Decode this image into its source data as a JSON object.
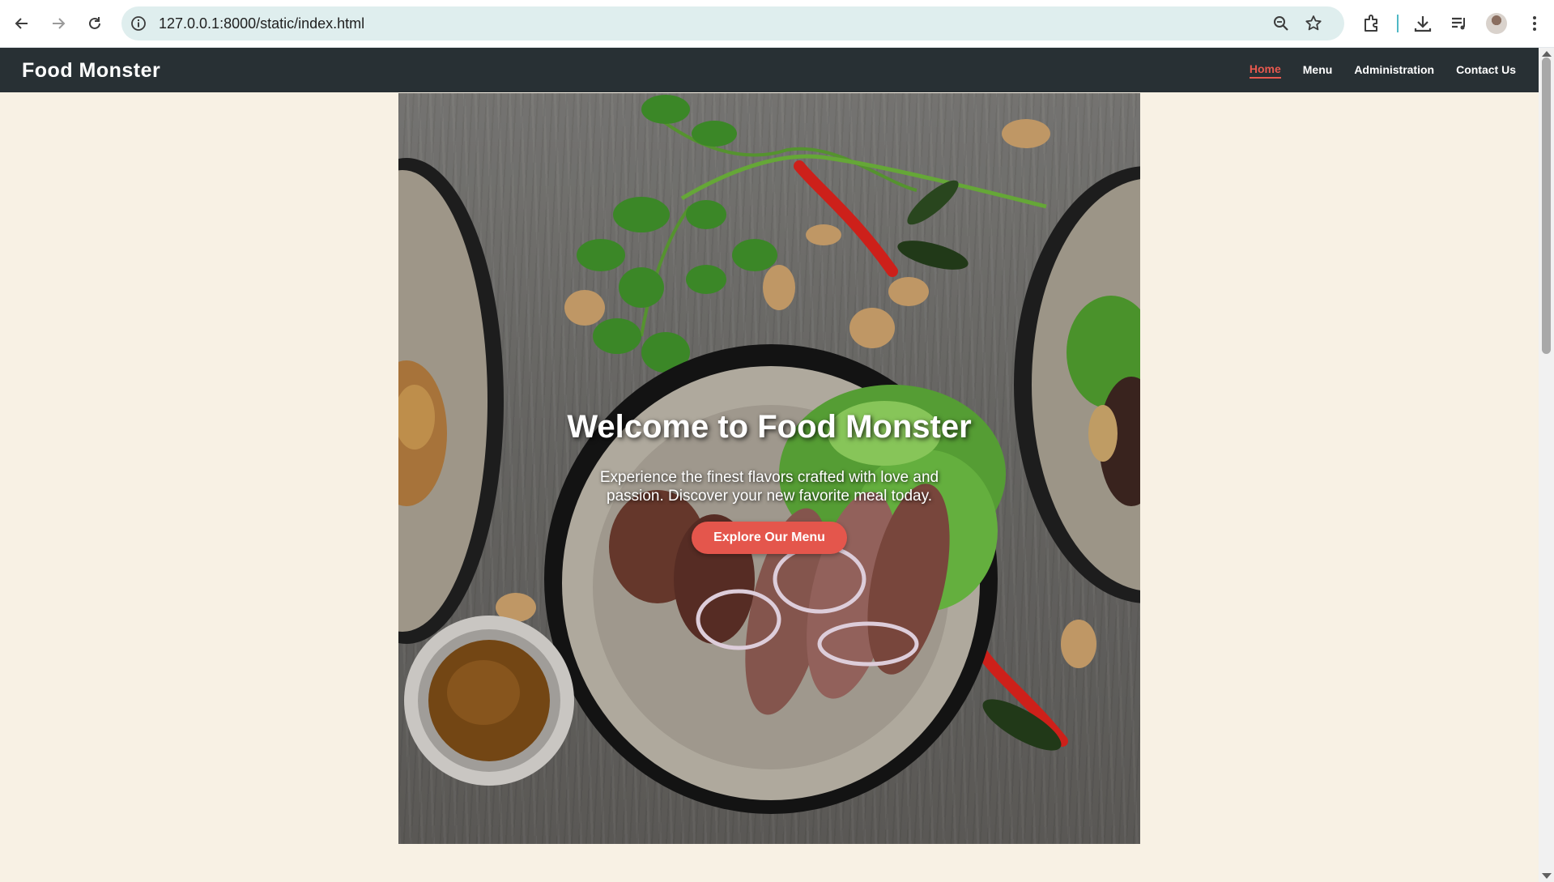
{
  "browser": {
    "url": "127.0.0.1:8000/static/index.html"
  },
  "site": {
    "brand": "Food Monster",
    "nav": [
      {
        "label": "Home",
        "active": true
      },
      {
        "label": "Menu",
        "active": false
      },
      {
        "label": "Administration",
        "active": false
      },
      {
        "label": "Contact Us",
        "active": false
      }
    ],
    "accent_color": "#e4564c",
    "header_bg": "#283034",
    "page_bg": "#f8f1e4"
  },
  "hero": {
    "title": "Welcome to Food Monster",
    "subtitle": "Experience the finest flavors crafted with love and passion. Discover your new favorite meal today.",
    "cta_label": "Explore Our Menu"
  }
}
